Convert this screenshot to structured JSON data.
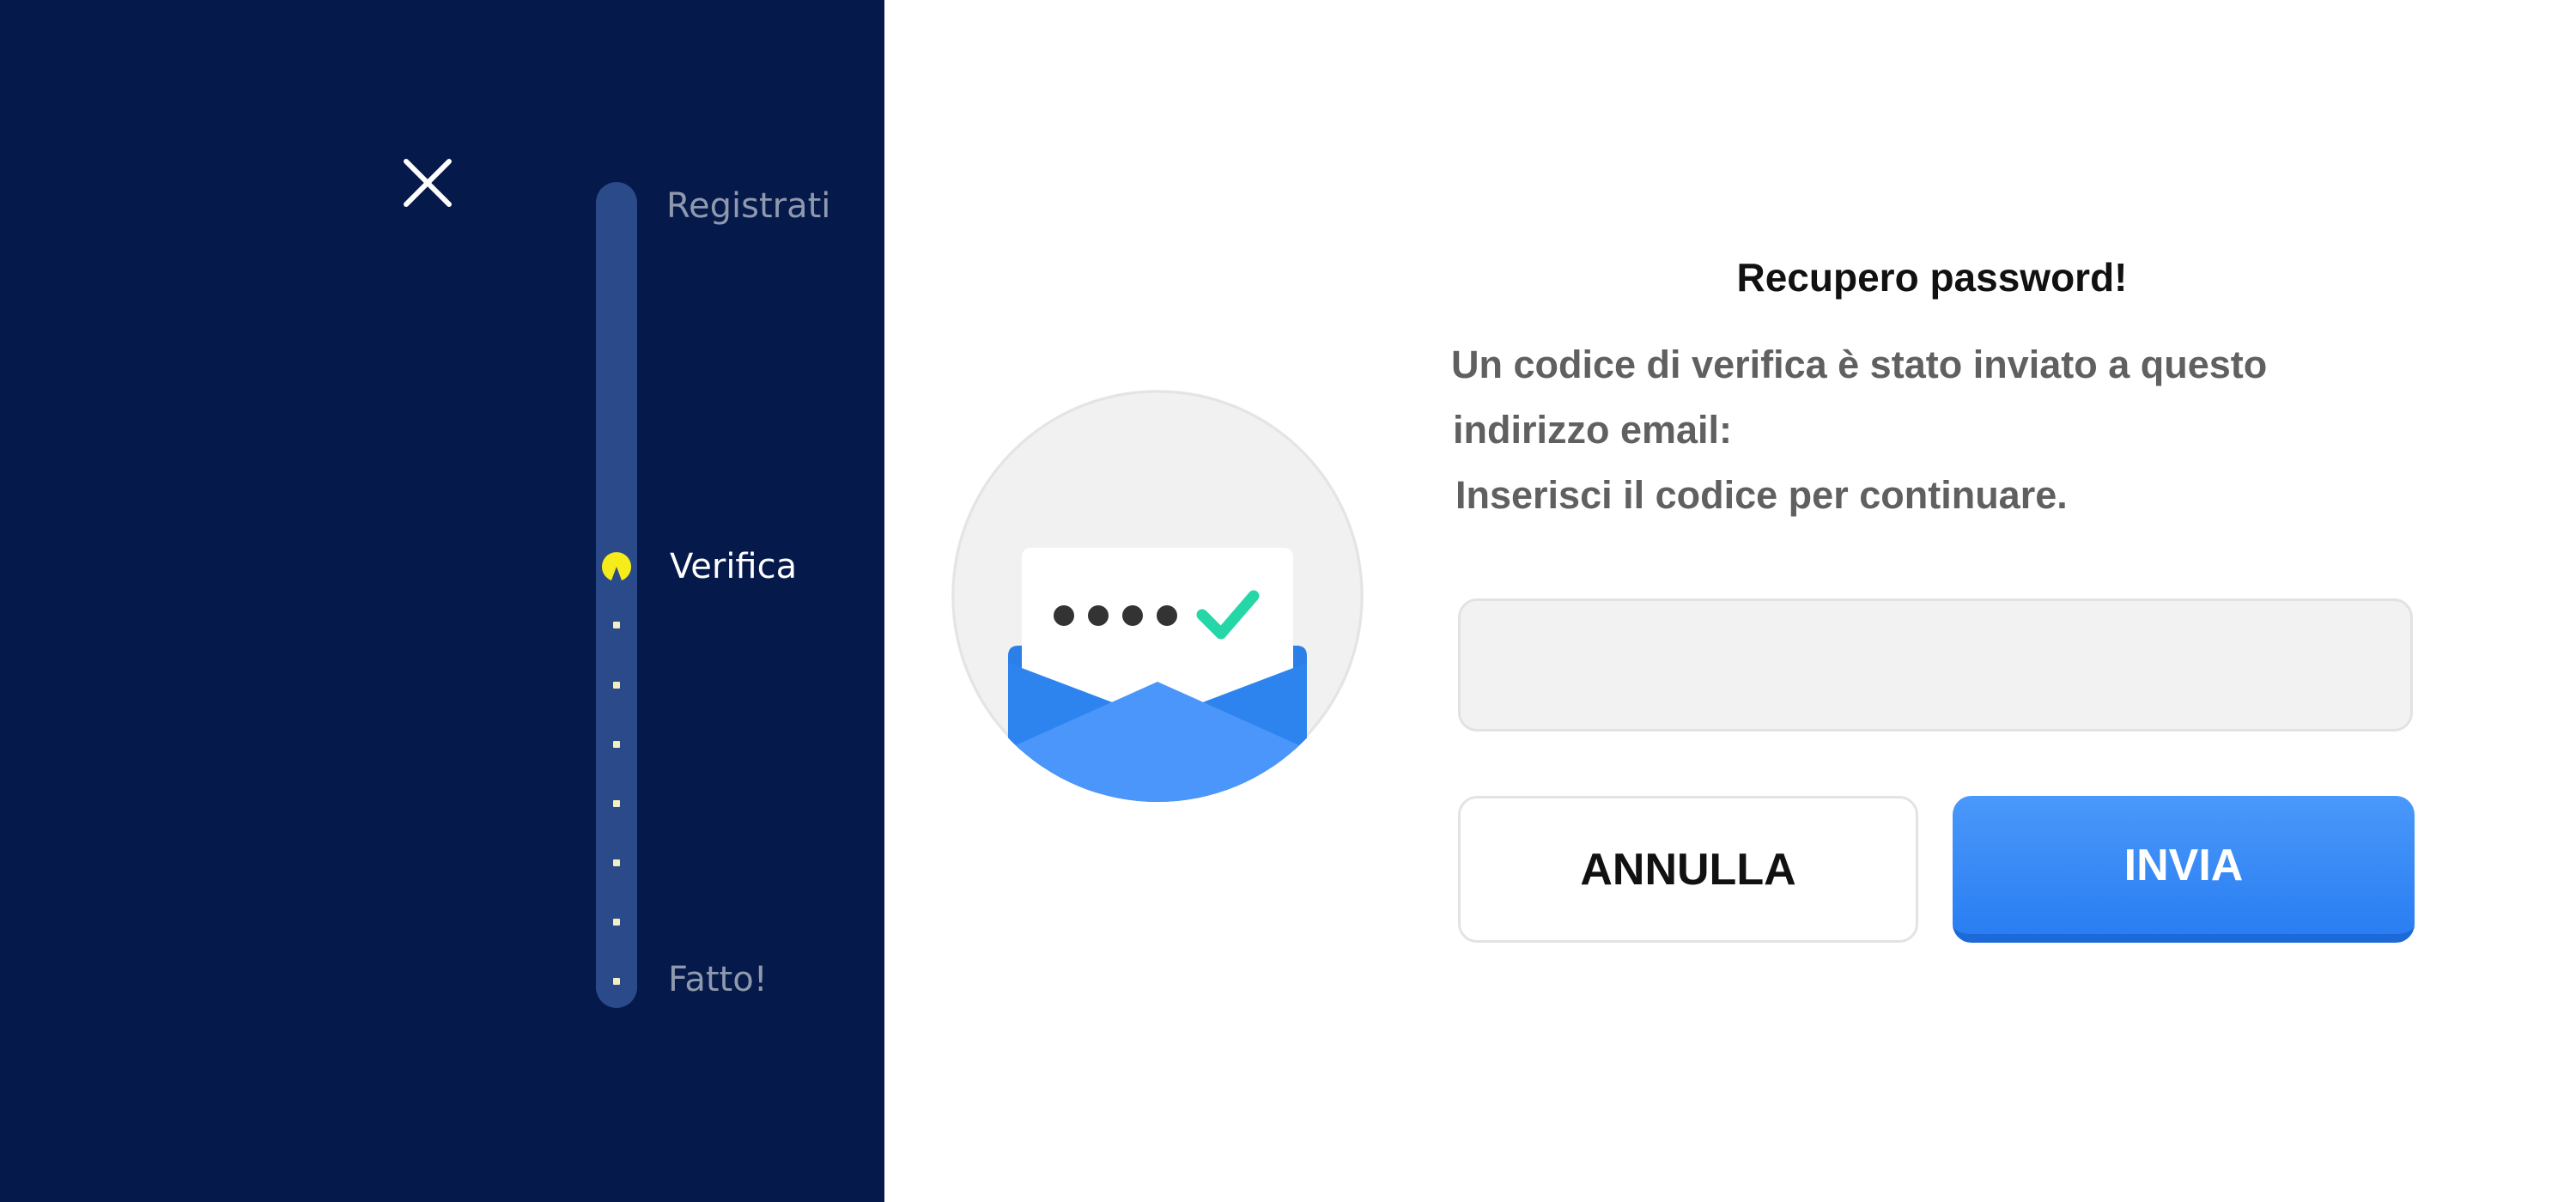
{
  "close_icon": "close-icon",
  "stepper": {
    "steps": [
      {
        "label": "Registrati",
        "state": "pending"
      },
      {
        "label": "Verifica",
        "state": "current"
      },
      {
        "label": "Fatto!",
        "state": "pending"
      }
    ],
    "current_icon": "pacman-icon",
    "colors": {
      "track": "#2a4a8a",
      "current": "#f5ec1a",
      "active_label": "#ffffff",
      "inactive_label": "#8f99ad"
    }
  },
  "illustration_icon": "email-code-verified-icon",
  "form": {
    "title": "Recupero password!",
    "message_lines": [
      "Un codice di verifica è stato inviato a questo",
      "indirizzo email:",
      "Inserisci il codice per continuare."
    ],
    "code_input": {
      "value": "",
      "placeholder": ""
    },
    "cancel_label": "ANNULLA",
    "send_label": "INVIA"
  },
  "colors": {
    "sidebar_bg": "#05194a",
    "primary": "#3b8cf7",
    "text_gray": "#606060"
  }
}
